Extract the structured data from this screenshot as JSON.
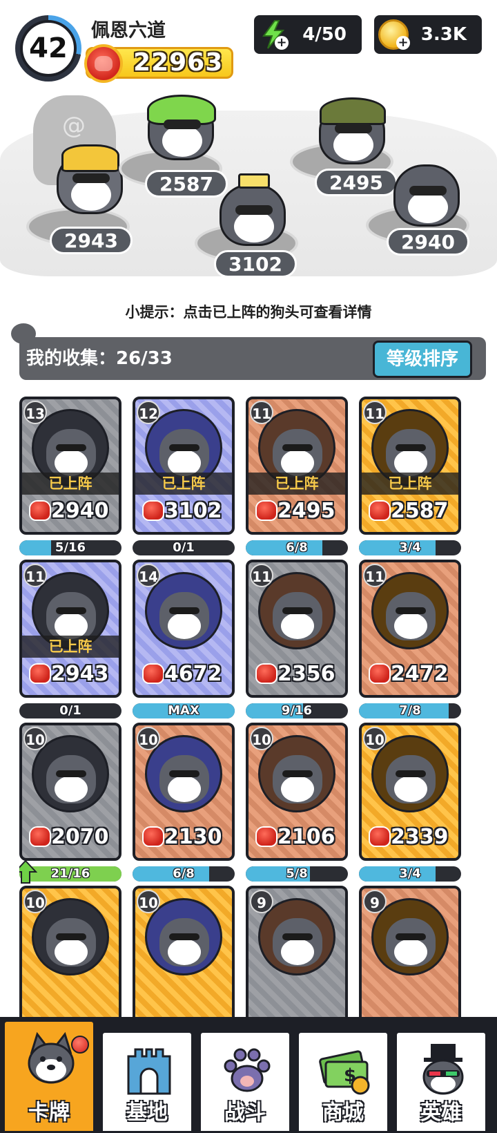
{
  "player": {
    "level": "42",
    "name": "佩恩六道",
    "power": "22963"
  },
  "resources": {
    "energy": "4/50",
    "coins": "3.3K"
  },
  "lineup": [
    {
      "power": "2943",
      "look": "gold-armor"
    },
    {
      "power": "2587",
      "look": "dino-hood"
    },
    {
      "power": "3102",
      "look": "crown-shades"
    },
    {
      "power": "2495",
      "look": "army-helmet"
    },
    {
      "power": "2940",
      "look": "plain"
    }
  ],
  "hint": "小提示：点击已上阵的狗头可查看详情",
  "collection": {
    "label": "我的收集：26/33",
    "sort_button": "等级排序"
  },
  "deployed_label": "已上阵",
  "cards": [
    {
      "level": "13",
      "power": "2940",
      "progress_text": "5/16",
      "progress": 0.31,
      "rarity": "gray",
      "deployed": true
    },
    {
      "level": "12",
      "power": "3102",
      "progress_text": "0/1",
      "progress": 0,
      "rarity": "purple",
      "deployed": true
    },
    {
      "level": "11",
      "power": "2495",
      "progress_text": "6/8",
      "progress": 0.75,
      "rarity": "bronze",
      "deployed": true
    },
    {
      "level": "11",
      "power": "2587",
      "progress_text": "3/4",
      "progress": 0.75,
      "rarity": "gold",
      "deployed": true
    },
    {
      "level": "11",
      "power": "2943",
      "progress_text": "0/1",
      "progress": 0,
      "rarity": "purple",
      "deployed": true
    },
    {
      "level": "14",
      "power": "4672",
      "progress_text": "MAX",
      "progress": 1,
      "rarity": "purple",
      "deployed": false
    },
    {
      "level": "11",
      "power": "2356",
      "progress_text": "9/16",
      "progress": 0.56,
      "rarity": "gray",
      "deployed": false
    },
    {
      "level": "11",
      "power": "2472",
      "progress_text": "7/8",
      "progress": 0.88,
      "rarity": "bronze",
      "deployed": false
    },
    {
      "level": "10",
      "power": "2070",
      "progress_text": "21/16",
      "progress": 1,
      "rarity": "gray",
      "deployed": false,
      "upgradable": true
    },
    {
      "level": "10",
      "power": "2130",
      "progress_text": "6/8",
      "progress": 0.75,
      "rarity": "bronze",
      "deployed": false
    },
    {
      "level": "10",
      "power": "2106",
      "progress_text": "5/8",
      "progress": 0.63,
      "rarity": "bronze",
      "deployed": false
    },
    {
      "level": "10",
      "power": "2339",
      "progress_text": "3/4",
      "progress": 0.75,
      "rarity": "gold",
      "deployed": false
    },
    {
      "level": "10",
      "power": "",
      "progress_text": "",
      "progress": 0,
      "rarity": "gold",
      "deployed": false
    },
    {
      "level": "10",
      "power": "",
      "progress_text": "",
      "progress": 0,
      "rarity": "gold",
      "deployed": false
    },
    {
      "level": "9",
      "power": "",
      "progress_text": "",
      "progress": 0,
      "rarity": "gray",
      "deployed": false
    },
    {
      "level": "9",
      "power": "",
      "progress_text": "",
      "progress": 0,
      "rarity": "bronze",
      "deployed": false
    }
  ],
  "nav": [
    {
      "label": "卡牌",
      "icon": "dog-head-icon",
      "active": true,
      "badge": true
    },
    {
      "label": "基地",
      "icon": "castle-icon",
      "active": false
    },
    {
      "label": "战斗",
      "icon": "paw-icon",
      "active": false
    },
    {
      "label": "商城",
      "icon": "money-icon",
      "active": false
    },
    {
      "label": "英雄",
      "icon": "hero-dog-icon",
      "active": false
    }
  ],
  "colors": {
    "accent": "#f7a51f",
    "sort_button": "#48b6d6",
    "progress": "#4fb8de",
    "power_red": "#d1261c"
  }
}
